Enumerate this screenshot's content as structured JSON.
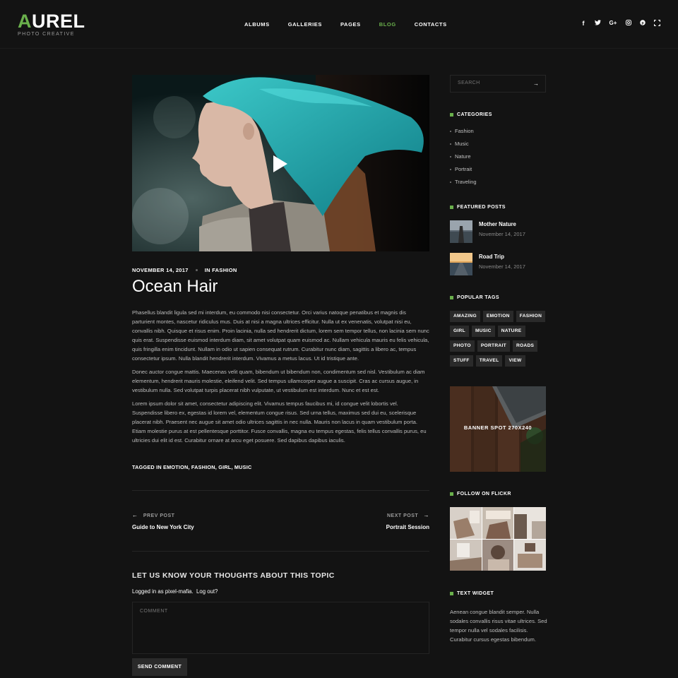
{
  "logo": {
    "accent_letter": "A",
    "rest": "UREL",
    "tagline": "PHOTO CREATIVE"
  },
  "nav": [
    {
      "label": "ALBUMS"
    },
    {
      "label": "GALLERIES"
    },
    {
      "label": "PAGES"
    },
    {
      "label": "BLOG",
      "active": true
    },
    {
      "label": "CONTACTS"
    }
  ],
  "social_icons": [
    "facebook-icon",
    "twitter-icon",
    "google-plus-icon",
    "instagram-icon",
    "pinterest-icon",
    "fullscreen-icon"
  ],
  "post": {
    "date": "NOVEMBER 14, 2017",
    "category": "IN FASHION",
    "title": "Ocean Hair",
    "paragraphs": [
      "Phasellus blandit ligula sed mi interdum, eu commodo nisi consectetur. Orci varius natoque penatibus et magnis dis parturient montes, nascetur ridiculus mus. Duis at nisi a magna ultrices efficitur. Nulla ut ex venenatis, volutpat nisi eu, convallis nibh. Quisque et risus enim. Proin lacinia, nulla sed hendrerit dictum, lorem sem tempor tellus, non lacinia sem nunc quis erat. Suspendisse euismod interdum diam, sit amet volutpat quam euismod ac. Nullam vehicula mauris eu felis vehicula, quis fringilla enim tincidunt. Nullam in odio ut sapien consequat rutrum. Curabitur nunc diam, sagittis a libero ac, tempus consectetur ipsum. Nulla blandit hendrerit interdum. Vivamus a metus lacus. Ut id tristique ante.",
      "Donec auctor congue mattis. Maecenas velit quam, bibendum ut bibendum non, condimentum sed nisl. Vestibulum ac diam elementum, hendrerit mauris molestie, eleifend velit. Sed tempus ullamcorper augue a suscipit. Cras ac cursus augue, in vestibulum nulla. Sed volutpat turpis placerat nibh vulputate, ut vestibulum est interdum. Nunc et est est.",
      "Lorem ipsum dolor sit amet, consectetur adipiscing elit. Vivamus tempus faucibus mi, id congue velit lobortis vel. Suspendisse libero ex, egestas id lorem vel, elementum congue risus. Sed urna tellus, maximus sed dui eu, scelerisque placerat nibh. Praesent nec augue sit amet odio ultrices sagittis in nec nulla. Mauris non lacus in quam vestibulum porta. Etiam molestie purus at est pellentesque porttitor. Fusce convallis, magna eu tempus egestas, felis tellus convallis purus, eu ultricies dui elit id est. Curabitur ornare at arcu eget posuere. Sed dapibus dapibus iaculis."
    ],
    "tagged": "TAGGED IN EMOTION, FASHION, GIRL, MUSIC"
  },
  "post_nav": {
    "prev_label": "PREV POST",
    "prev_title": "Guide to New York City",
    "next_label": "NEXT POST",
    "next_title": "Portrait Session"
  },
  "comments": {
    "heading": "LET US KNOW YOUR THOUGHTS ABOUT THIS TOPIC",
    "logged_in_prefix": "Logged in as pixel-mafia.",
    "logout_label": "Log out?",
    "placeholder": "COMMENT",
    "submit_label": "SEND COMMENT"
  },
  "sidebar": {
    "search_placeholder": "SEARCH",
    "categories_title": "CATEGORIES",
    "categories": [
      "Fashion",
      "Music",
      "Nature",
      "Portrait",
      "Traveling"
    ],
    "featured_title": "FEATURED POSTS",
    "featured": [
      {
        "title": "Mother Nature",
        "date": "November 14, 2017"
      },
      {
        "title": "Road Trip",
        "date": "November 14, 2017"
      }
    ],
    "tags_title": "POPULAR TAGS",
    "tags": [
      "AMAZING",
      "EMOTION",
      "FASHION",
      "GIRL",
      "MUSIC",
      "NATURE",
      "PHOTO",
      "PORTRAIT",
      "ROADS",
      "STUFF",
      "TRAVEL",
      "VIEW"
    ],
    "banner_label": "BANNER SPOT 270X240",
    "flickr_title": "FOLLOW ON FLICKR",
    "text_widget_title": "TEXT WIDGET",
    "text_widget_body": "Aenean congue blandit semper. Nulla sodales convallis risus vitae ultrices. Sed tempor nulla vel sodales facilisis. Curabitur cursus egestas bibendum."
  },
  "colors": {
    "accent": "#6ab04c",
    "background": "#131313"
  }
}
